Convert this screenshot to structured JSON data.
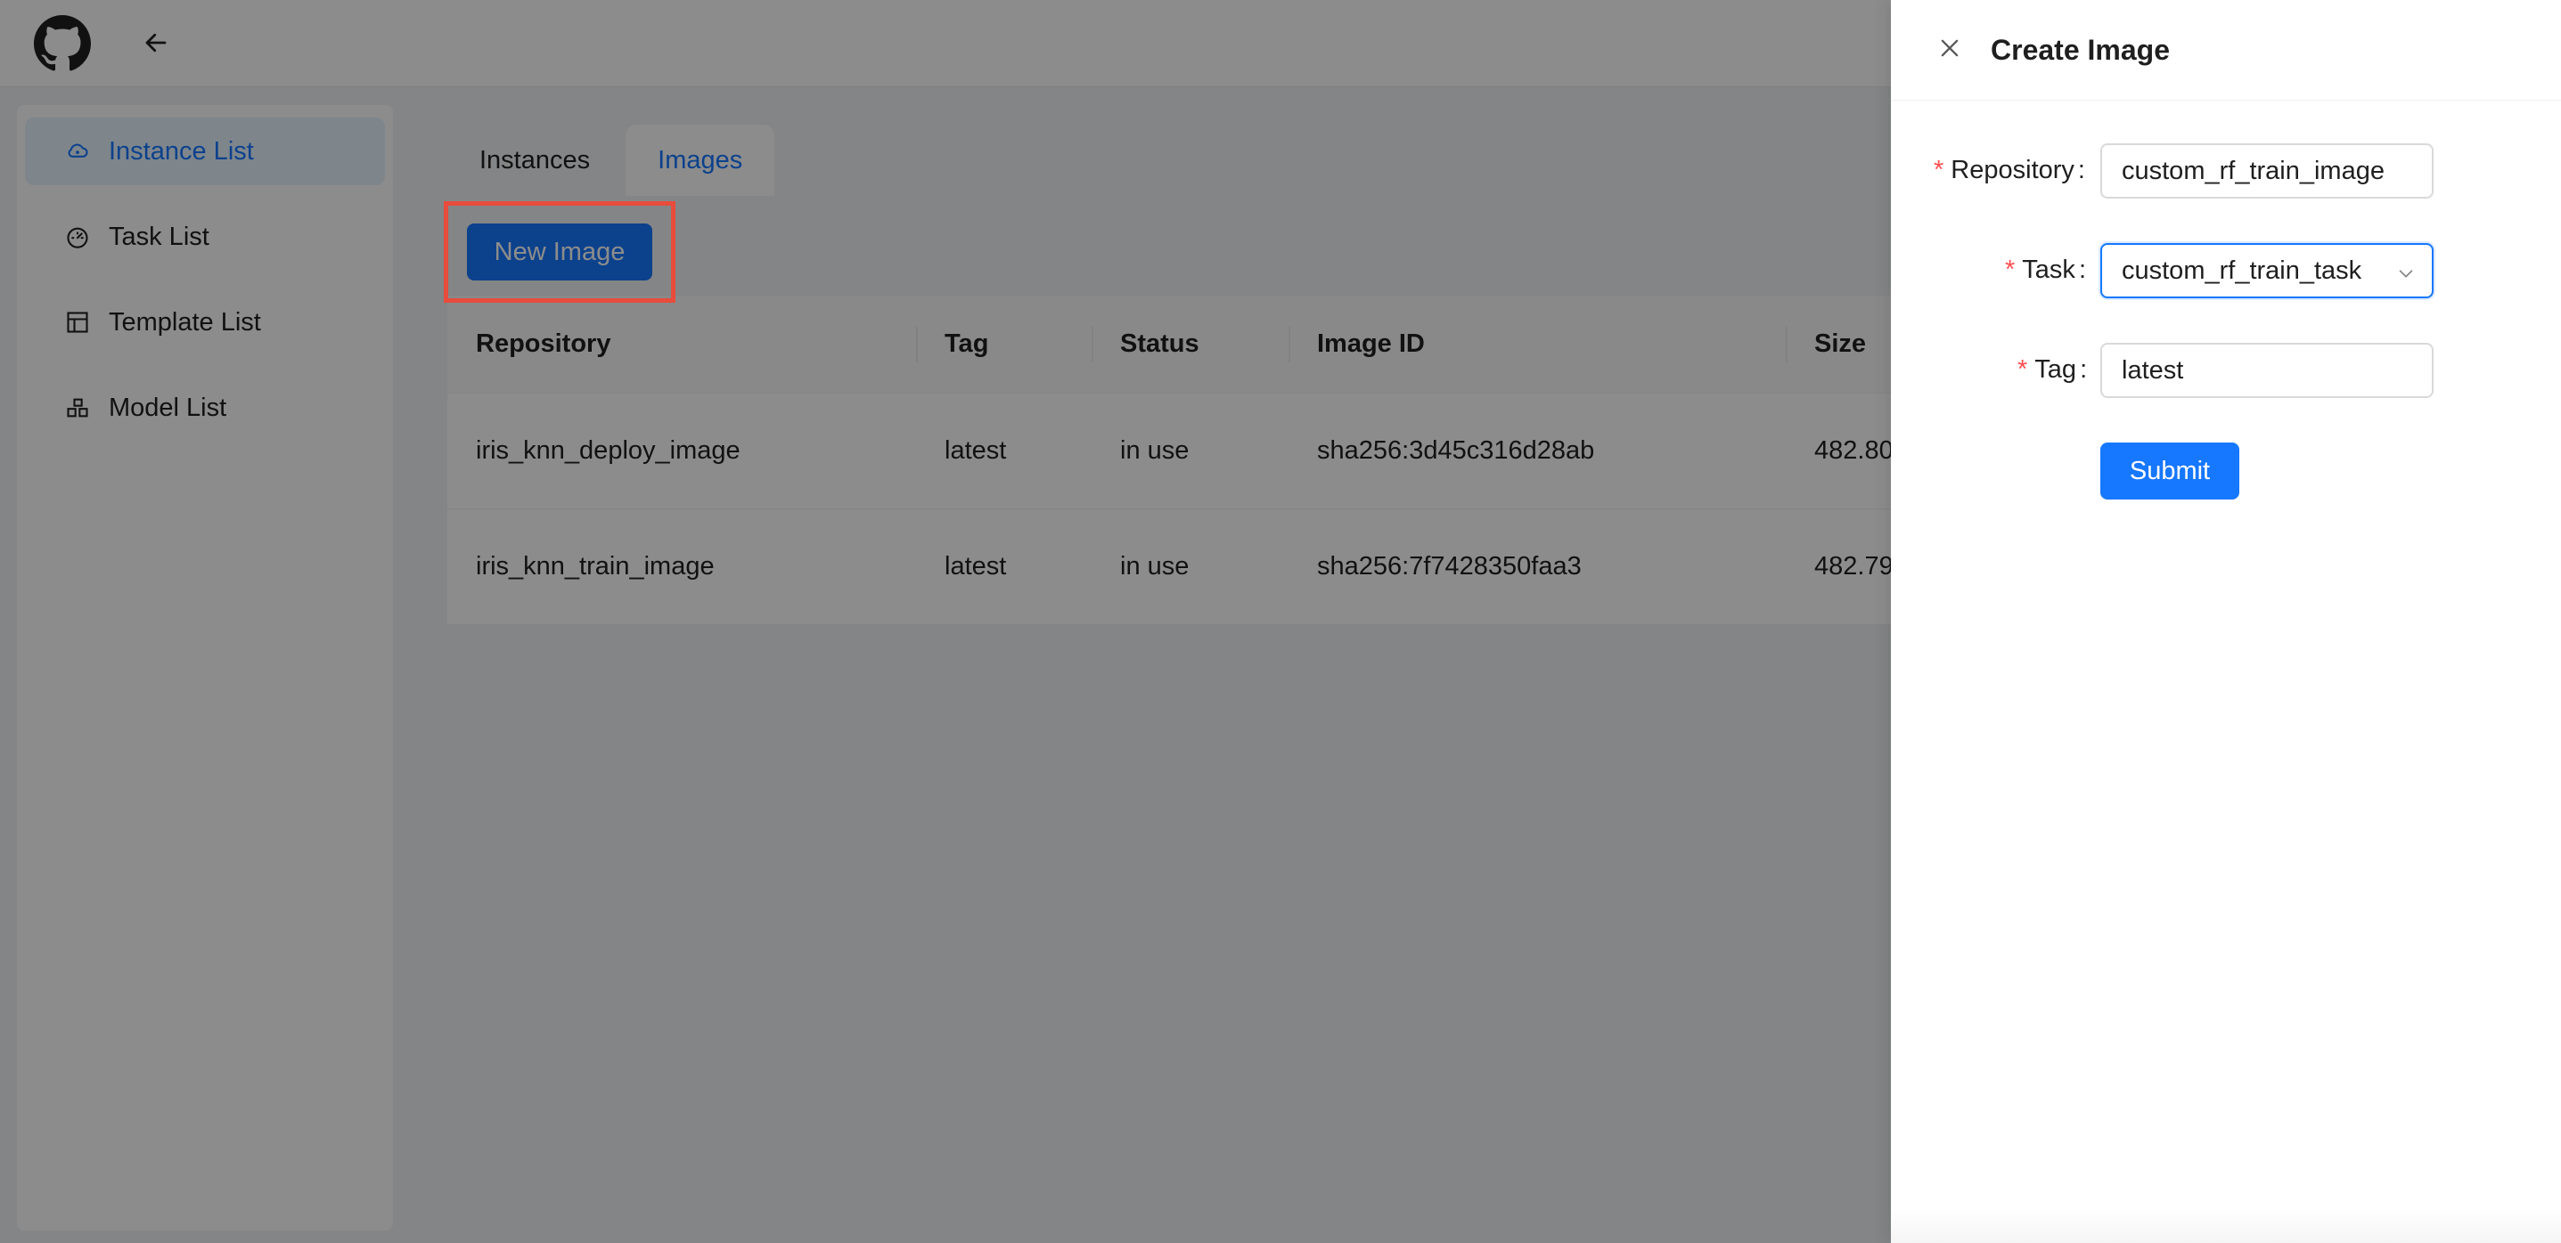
{
  "header": {
    "logo_icon": "github-icon",
    "back_icon": "arrow-left-icon"
  },
  "sidebar": {
    "items": [
      {
        "label": "Instance List",
        "icon": "cloud-server-icon",
        "active": true
      },
      {
        "label": "Task List",
        "icon": "dashboard-icon",
        "active": false
      },
      {
        "label": "Template List",
        "icon": "layout-icon",
        "active": false
      },
      {
        "label": "Model List",
        "icon": "cluster-icon",
        "active": false
      }
    ]
  },
  "main": {
    "tabs": [
      {
        "label": "Instances",
        "active": false
      },
      {
        "label": "Images",
        "active": true
      }
    ],
    "new_button_label": "New Image",
    "table": {
      "columns": [
        "Repository",
        "Tag",
        "Status",
        "Image ID",
        "Size"
      ],
      "rows": [
        {
          "repository": "iris_knn_deploy_image",
          "tag": "latest",
          "status": "in use",
          "image_id": "sha256:3d45c316d28ab",
          "size": "482.80"
        },
        {
          "repository": "iris_knn_train_image",
          "tag": "latest",
          "status": "in use",
          "image_id": "sha256:7f7428350faa3",
          "size": "482.79"
        }
      ]
    }
  },
  "drawer": {
    "title": "Create Image",
    "close_icon": "close-icon",
    "fields": {
      "repository": {
        "label": "Repository",
        "value": "custom_rf_train_image",
        "required": "*"
      },
      "task": {
        "label": "Task",
        "value": "custom_rf_train_task",
        "required": "*"
      },
      "tag": {
        "label": "Tag",
        "value": "latest",
        "required": "*"
      }
    },
    "colon": ":",
    "submit_label": "Submit"
  },
  "colors": {
    "accent": "#1677ff",
    "required": "#ff4d4f",
    "highlight": "#e74c3c",
    "active_bg": "#e6f4ff"
  }
}
